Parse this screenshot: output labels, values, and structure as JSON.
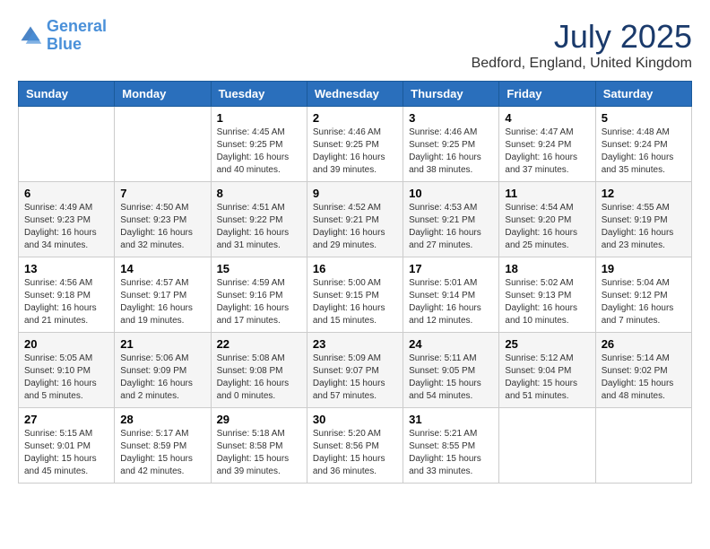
{
  "header": {
    "logo_line1": "General",
    "logo_line2": "Blue",
    "month_title": "July 2025",
    "location": "Bedford, England, United Kingdom"
  },
  "days_of_week": [
    "Sunday",
    "Monday",
    "Tuesday",
    "Wednesday",
    "Thursday",
    "Friday",
    "Saturday"
  ],
  "weeks": [
    [
      {
        "day": "",
        "sunrise": "",
        "sunset": "",
        "daylight": ""
      },
      {
        "day": "",
        "sunrise": "",
        "sunset": "",
        "daylight": ""
      },
      {
        "day": "1",
        "sunrise": "Sunrise: 4:45 AM",
        "sunset": "Sunset: 9:25 PM",
        "daylight": "Daylight: 16 hours and 40 minutes."
      },
      {
        "day": "2",
        "sunrise": "Sunrise: 4:46 AM",
        "sunset": "Sunset: 9:25 PM",
        "daylight": "Daylight: 16 hours and 39 minutes."
      },
      {
        "day": "3",
        "sunrise": "Sunrise: 4:46 AM",
        "sunset": "Sunset: 9:25 PM",
        "daylight": "Daylight: 16 hours and 38 minutes."
      },
      {
        "day": "4",
        "sunrise": "Sunrise: 4:47 AM",
        "sunset": "Sunset: 9:24 PM",
        "daylight": "Daylight: 16 hours and 37 minutes."
      },
      {
        "day": "5",
        "sunrise": "Sunrise: 4:48 AM",
        "sunset": "Sunset: 9:24 PM",
        "daylight": "Daylight: 16 hours and 35 minutes."
      }
    ],
    [
      {
        "day": "6",
        "sunrise": "Sunrise: 4:49 AM",
        "sunset": "Sunset: 9:23 PM",
        "daylight": "Daylight: 16 hours and 34 minutes."
      },
      {
        "day": "7",
        "sunrise": "Sunrise: 4:50 AM",
        "sunset": "Sunset: 9:23 PM",
        "daylight": "Daylight: 16 hours and 32 minutes."
      },
      {
        "day": "8",
        "sunrise": "Sunrise: 4:51 AM",
        "sunset": "Sunset: 9:22 PM",
        "daylight": "Daylight: 16 hours and 31 minutes."
      },
      {
        "day": "9",
        "sunrise": "Sunrise: 4:52 AM",
        "sunset": "Sunset: 9:21 PM",
        "daylight": "Daylight: 16 hours and 29 minutes."
      },
      {
        "day": "10",
        "sunrise": "Sunrise: 4:53 AM",
        "sunset": "Sunset: 9:21 PM",
        "daylight": "Daylight: 16 hours and 27 minutes."
      },
      {
        "day": "11",
        "sunrise": "Sunrise: 4:54 AM",
        "sunset": "Sunset: 9:20 PM",
        "daylight": "Daylight: 16 hours and 25 minutes."
      },
      {
        "day": "12",
        "sunrise": "Sunrise: 4:55 AM",
        "sunset": "Sunset: 9:19 PM",
        "daylight": "Daylight: 16 hours and 23 minutes."
      }
    ],
    [
      {
        "day": "13",
        "sunrise": "Sunrise: 4:56 AM",
        "sunset": "Sunset: 9:18 PM",
        "daylight": "Daylight: 16 hours and 21 minutes."
      },
      {
        "day": "14",
        "sunrise": "Sunrise: 4:57 AM",
        "sunset": "Sunset: 9:17 PM",
        "daylight": "Daylight: 16 hours and 19 minutes."
      },
      {
        "day": "15",
        "sunrise": "Sunrise: 4:59 AM",
        "sunset": "Sunset: 9:16 PM",
        "daylight": "Daylight: 16 hours and 17 minutes."
      },
      {
        "day": "16",
        "sunrise": "Sunrise: 5:00 AM",
        "sunset": "Sunset: 9:15 PM",
        "daylight": "Daylight: 16 hours and 15 minutes."
      },
      {
        "day": "17",
        "sunrise": "Sunrise: 5:01 AM",
        "sunset": "Sunset: 9:14 PM",
        "daylight": "Daylight: 16 hours and 12 minutes."
      },
      {
        "day": "18",
        "sunrise": "Sunrise: 5:02 AM",
        "sunset": "Sunset: 9:13 PM",
        "daylight": "Daylight: 16 hours and 10 minutes."
      },
      {
        "day": "19",
        "sunrise": "Sunrise: 5:04 AM",
        "sunset": "Sunset: 9:12 PM",
        "daylight": "Daylight: 16 hours and 7 minutes."
      }
    ],
    [
      {
        "day": "20",
        "sunrise": "Sunrise: 5:05 AM",
        "sunset": "Sunset: 9:10 PM",
        "daylight": "Daylight: 16 hours and 5 minutes."
      },
      {
        "day": "21",
        "sunrise": "Sunrise: 5:06 AM",
        "sunset": "Sunset: 9:09 PM",
        "daylight": "Daylight: 16 hours and 2 minutes."
      },
      {
        "day": "22",
        "sunrise": "Sunrise: 5:08 AM",
        "sunset": "Sunset: 9:08 PM",
        "daylight": "Daylight: 16 hours and 0 minutes."
      },
      {
        "day": "23",
        "sunrise": "Sunrise: 5:09 AM",
        "sunset": "Sunset: 9:07 PM",
        "daylight": "Daylight: 15 hours and 57 minutes."
      },
      {
        "day": "24",
        "sunrise": "Sunrise: 5:11 AM",
        "sunset": "Sunset: 9:05 PM",
        "daylight": "Daylight: 15 hours and 54 minutes."
      },
      {
        "day": "25",
        "sunrise": "Sunrise: 5:12 AM",
        "sunset": "Sunset: 9:04 PM",
        "daylight": "Daylight: 15 hours and 51 minutes."
      },
      {
        "day": "26",
        "sunrise": "Sunrise: 5:14 AM",
        "sunset": "Sunset: 9:02 PM",
        "daylight": "Daylight: 15 hours and 48 minutes."
      }
    ],
    [
      {
        "day": "27",
        "sunrise": "Sunrise: 5:15 AM",
        "sunset": "Sunset: 9:01 PM",
        "daylight": "Daylight: 15 hours and 45 minutes."
      },
      {
        "day": "28",
        "sunrise": "Sunrise: 5:17 AM",
        "sunset": "Sunset: 8:59 PM",
        "daylight": "Daylight: 15 hours and 42 minutes."
      },
      {
        "day": "29",
        "sunrise": "Sunrise: 5:18 AM",
        "sunset": "Sunset: 8:58 PM",
        "daylight": "Daylight: 15 hours and 39 minutes."
      },
      {
        "day": "30",
        "sunrise": "Sunrise: 5:20 AM",
        "sunset": "Sunset: 8:56 PM",
        "daylight": "Daylight: 15 hours and 36 minutes."
      },
      {
        "day": "31",
        "sunrise": "Sunrise: 5:21 AM",
        "sunset": "Sunset: 8:55 PM",
        "daylight": "Daylight: 15 hours and 33 minutes."
      },
      {
        "day": "",
        "sunrise": "",
        "sunset": "",
        "daylight": ""
      },
      {
        "day": "",
        "sunrise": "",
        "sunset": "",
        "daylight": ""
      }
    ]
  ]
}
